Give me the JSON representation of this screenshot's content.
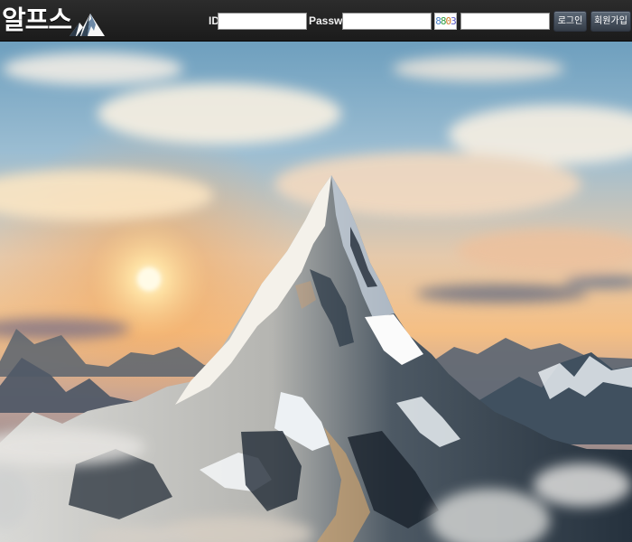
{
  "site": {
    "logo_text": "알프스",
    "logo_icon": "mountain-logo-icon"
  },
  "login": {
    "id_label": "ID",
    "id_value": "",
    "password_label": "Password",
    "password_value": "",
    "captcha_digits": [
      "8",
      "8",
      "0",
      "3"
    ],
    "captcha_input_value": "",
    "login_button": "로그인",
    "signup_button": "회원가입"
  },
  "theme": {
    "topbar": "#222222",
    "button": "#4b5563",
    "input": "#ffffff"
  },
  "hero": {
    "image": "alpine-mountain-sunset-background"
  }
}
